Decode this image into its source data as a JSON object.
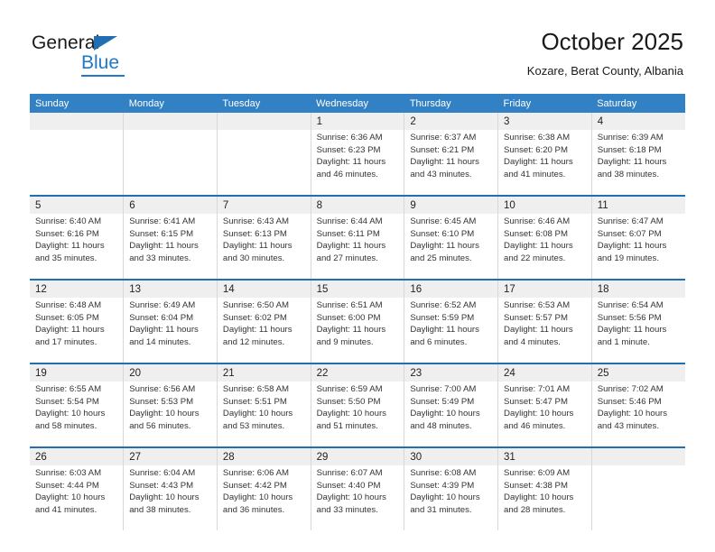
{
  "brand": {
    "name_top": "General",
    "name_bottom": "Blue",
    "accent_color": "#2079c4",
    "triangle_color": "#1f6fb2"
  },
  "header": {
    "title": "October 2025",
    "subtitle": "Kozare, Berat County, Albania"
  },
  "calendar": {
    "header_bg": "#3281c4",
    "daynum_bg": "#efefef",
    "week_separator_color": "#1f6fb2",
    "weekday_headers": [
      "Sunday",
      "Monday",
      "Tuesday",
      "Wednesday",
      "Thursday",
      "Friday",
      "Saturday"
    ],
    "weeks": [
      [
        {
          "day": "",
          "sunrise": "",
          "sunset": "",
          "daylight_line1": "",
          "daylight_line2": ""
        },
        {
          "day": "",
          "sunrise": "",
          "sunset": "",
          "daylight_line1": "",
          "daylight_line2": ""
        },
        {
          "day": "",
          "sunrise": "",
          "sunset": "",
          "daylight_line1": "",
          "daylight_line2": ""
        },
        {
          "day": "1",
          "sunrise": "Sunrise: 6:36 AM",
          "sunset": "Sunset: 6:23 PM",
          "daylight_line1": "Daylight: 11 hours",
          "daylight_line2": "and 46 minutes."
        },
        {
          "day": "2",
          "sunrise": "Sunrise: 6:37 AM",
          "sunset": "Sunset: 6:21 PM",
          "daylight_line1": "Daylight: 11 hours",
          "daylight_line2": "and 43 minutes."
        },
        {
          "day": "3",
          "sunrise": "Sunrise: 6:38 AM",
          "sunset": "Sunset: 6:20 PM",
          "daylight_line1": "Daylight: 11 hours",
          "daylight_line2": "and 41 minutes."
        },
        {
          "day": "4",
          "sunrise": "Sunrise: 6:39 AM",
          "sunset": "Sunset: 6:18 PM",
          "daylight_line1": "Daylight: 11 hours",
          "daylight_line2": "and 38 minutes."
        }
      ],
      [
        {
          "day": "5",
          "sunrise": "Sunrise: 6:40 AM",
          "sunset": "Sunset: 6:16 PM",
          "daylight_line1": "Daylight: 11 hours",
          "daylight_line2": "and 35 minutes."
        },
        {
          "day": "6",
          "sunrise": "Sunrise: 6:41 AM",
          "sunset": "Sunset: 6:15 PM",
          "daylight_line1": "Daylight: 11 hours",
          "daylight_line2": "and 33 minutes."
        },
        {
          "day": "7",
          "sunrise": "Sunrise: 6:43 AM",
          "sunset": "Sunset: 6:13 PM",
          "daylight_line1": "Daylight: 11 hours",
          "daylight_line2": "and 30 minutes."
        },
        {
          "day": "8",
          "sunrise": "Sunrise: 6:44 AM",
          "sunset": "Sunset: 6:11 PM",
          "daylight_line1": "Daylight: 11 hours",
          "daylight_line2": "and 27 minutes."
        },
        {
          "day": "9",
          "sunrise": "Sunrise: 6:45 AM",
          "sunset": "Sunset: 6:10 PM",
          "daylight_line1": "Daylight: 11 hours",
          "daylight_line2": "and 25 minutes."
        },
        {
          "day": "10",
          "sunrise": "Sunrise: 6:46 AM",
          "sunset": "Sunset: 6:08 PM",
          "daylight_line1": "Daylight: 11 hours",
          "daylight_line2": "and 22 minutes."
        },
        {
          "day": "11",
          "sunrise": "Sunrise: 6:47 AM",
          "sunset": "Sunset: 6:07 PM",
          "daylight_line1": "Daylight: 11 hours",
          "daylight_line2": "and 19 minutes."
        }
      ],
      [
        {
          "day": "12",
          "sunrise": "Sunrise: 6:48 AM",
          "sunset": "Sunset: 6:05 PM",
          "daylight_line1": "Daylight: 11 hours",
          "daylight_line2": "and 17 minutes."
        },
        {
          "day": "13",
          "sunrise": "Sunrise: 6:49 AM",
          "sunset": "Sunset: 6:04 PM",
          "daylight_line1": "Daylight: 11 hours",
          "daylight_line2": "and 14 minutes."
        },
        {
          "day": "14",
          "sunrise": "Sunrise: 6:50 AM",
          "sunset": "Sunset: 6:02 PM",
          "daylight_line1": "Daylight: 11 hours",
          "daylight_line2": "and 12 minutes."
        },
        {
          "day": "15",
          "sunrise": "Sunrise: 6:51 AM",
          "sunset": "Sunset: 6:00 PM",
          "daylight_line1": "Daylight: 11 hours",
          "daylight_line2": "and 9 minutes."
        },
        {
          "day": "16",
          "sunrise": "Sunrise: 6:52 AM",
          "sunset": "Sunset: 5:59 PM",
          "daylight_line1": "Daylight: 11 hours",
          "daylight_line2": "and 6 minutes."
        },
        {
          "day": "17",
          "sunrise": "Sunrise: 6:53 AM",
          "sunset": "Sunset: 5:57 PM",
          "daylight_line1": "Daylight: 11 hours",
          "daylight_line2": "and 4 minutes."
        },
        {
          "day": "18",
          "sunrise": "Sunrise: 6:54 AM",
          "sunset": "Sunset: 5:56 PM",
          "daylight_line1": "Daylight: 11 hours",
          "daylight_line2": "and 1 minute."
        }
      ],
      [
        {
          "day": "19",
          "sunrise": "Sunrise: 6:55 AM",
          "sunset": "Sunset: 5:54 PM",
          "daylight_line1": "Daylight: 10 hours",
          "daylight_line2": "and 58 minutes."
        },
        {
          "day": "20",
          "sunrise": "Sunrise: 6:56 AM",
          "sunset": "Sunset: 5:53 PM",
          "daylight_line1": "Daylight: 10 hours",
          "daylight_line2": "and 56 minutes."
        },
        {
          "day": "21",
          "sunrise": "Sunrise: 6:58 AM",
          "sunset": "Sunset: 5:51 PM",
          "daylight_line1": "Daylight: 10 hours",
          "daylight_line2": "and 53 minutes."
        },
        {
          "day": "22",
          "sunrise": "Sunrise: 6:59 AM",
          "sunset": "Sunset: 5:50 PM",
          "daylight_line1": "Daylight: 10 hours",
          "daylight_line2": "and 51 minutes."
        },
        {
          "day": "23",
          "sunrise": "Sunrise: 7:00 AM",
          "sunset": "Sunset: 5:49 PM",
          "daylight_line1": "Daylight: 10 hours",
          "daylight_line2": "and 48 minutes."
        },
        {
          "day": "24",
          "sunrise": "Sunrise: 7:01 AM",
          "sunset": "Sunset: 5:47 PM",
          "daylight_line1": "Daylight: 10 hours",
          "daylight_line2": "and 46 minutes."
        },
        {
          "day": "25",
          "sunrise": "Sunrise: 7:02 AM",
          "sunset": "Sunset: 5:46 PM",
          "daylight_line1": "Daylight: 10 hours",
          "daylight_line2": "and 43 minutes."
        }
      ],
      [
        {
          "day": "26",
          "sunrise": "Sunrise: 6:03 AM",
          "sunset": "Sunset: 4:44 PM",
          "daylight_line1": "Daylight: 10 hours",
          "daylight_line2": "and 41 minutes."
        },
        {
          "day": "27",
          "sunrise": "Sunrise: 6:04 AM",
          "sunset": "Sunset: 4:43 PM",
          "daylight_line1": "Daylight: 10 hours",
          "daylight_line2": "and 38 minutes."
        },
        {
          "day": "28",
          "sunrise": "Sunrise: 6:06 AM",
          "sunset": "Sunset: 4:42 PM",
          "daylight_line1": "Daylight: 10 hours",
          "daylight_line2": "and 36 minutes."
        },
        {
          "day": "29",
          "sunrise": "Sunrise: 6:07 AM",
          "sunset": "Sunset: 4:40 PM",
          "daylight_line1": "Daylight: 10 hours",
          "daylight_line2": "and 33 minutes."
        },
        {
          "day": "30",
          "sunrise": "Sunrise: 6:08 AM",
          "sunset": "Sunset: 4:39 PM",
          "daylight_line1": "Daylight: 10 hours",
          "daylight_line2": "and 31 minutes."
        },
        {
          "day": "31",
          "sunrise": "Sunrise: 6:09 AM",
          "sunset": "Sunset: 4:38 PM",
          "daylight_line1": "Daylight: 10 hours",
          "daylight_line2": "and 28 minutes."
        },
        {
          "day": "",
          "sunrise": "",
          "sunset": "",
          "daylight_line1": "",
          "daylight_line2": ""
        }
      ]
    ]
  }
}
